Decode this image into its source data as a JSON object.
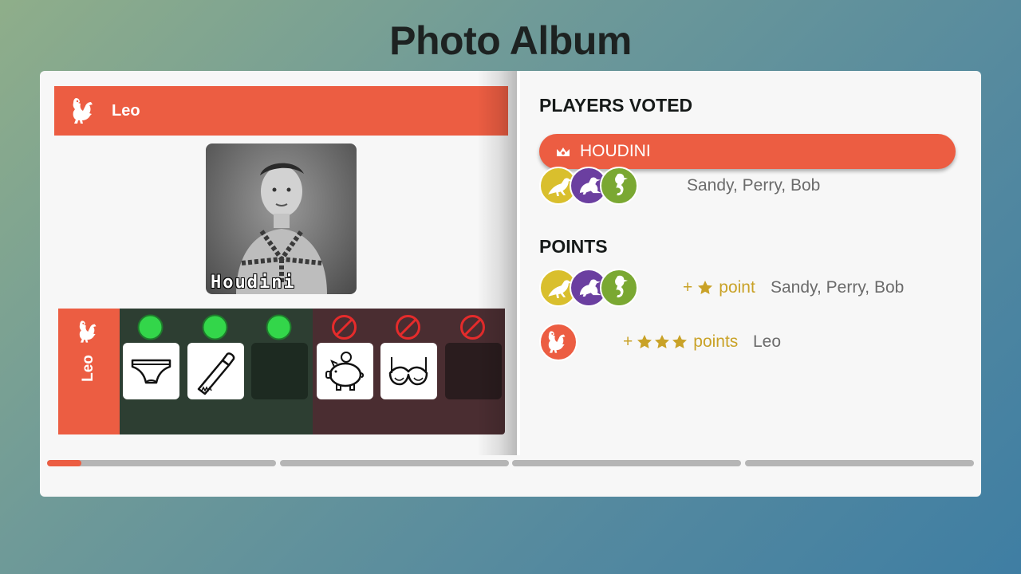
{
  "page": {
    "title": "Photo Album"
  },
  "current_player": {
    "name": "Leo",
    "avatar_icon": "rooster-icon",
    "color": "#ec5d42"
  },
  "photo": {
    "caption": "Houdini"
  },
  "items": {
    "player_label": "Leo",
    "good": [
      {
        "icon": "briefs-icon",
        "status": "green-check-circle"
      },
      {
        "icon": "saw-icon",
        "status": "green-check-circle"
      },
      {
        "icon": "",
        "status": "green-check-circle"
      }
    ],
    "bad": [
      {
        "icon": "piggy-bank-icon",
        "status": "no-entry-icon"
      },
      {
        "icon": "bra-icon",
        "status": "no-entry-icon"
      },
      {
        "icon": "",
        "status": "no-entry-icon"
      }
    ]
  },
  "players_voted": {
    "title": "PLAYERS VOTED",
    "answer": {
      "label": "HOUDINI",
      "icon": "crown-icon"
    },
    "voters": [
      {
        "name": "Sandy",
        "icon": "bird-icon",
        "color": "#d9bf2d"
      },
      {
        "name": "Perry",
        "icon": "platypus-icon",
        "color": "#6b3fa0"
      },
      {
        "name": "Bob",
        "icon": "seahorse-icon",
        "color": "#7aa832"
      }
    ],
    "names_text": "Sandy, Perry, Bob"
  },
  "points": {
    "title": "POINTS",
    "rows": [
      {
        "prefix": "+",
        "stars": 1,
        "unit": "point",
        "names_text": "Sandy, Perry, Bob"
      },
      {
        "prefix": "+",
        "stars": 3,
        "unit": "points",
        "names_text": "Leo"
      }
    ]
  },
  "progress": {
    "segments": 4,
    "current_segment_fill": 0.15
  },
  "colors": {
    "accent": "#ec5d42",
    "gold": "#c9a227",
    "good_bg": "#2d3e32",
    "bad_bg": "#4a2d31"
  }
}
